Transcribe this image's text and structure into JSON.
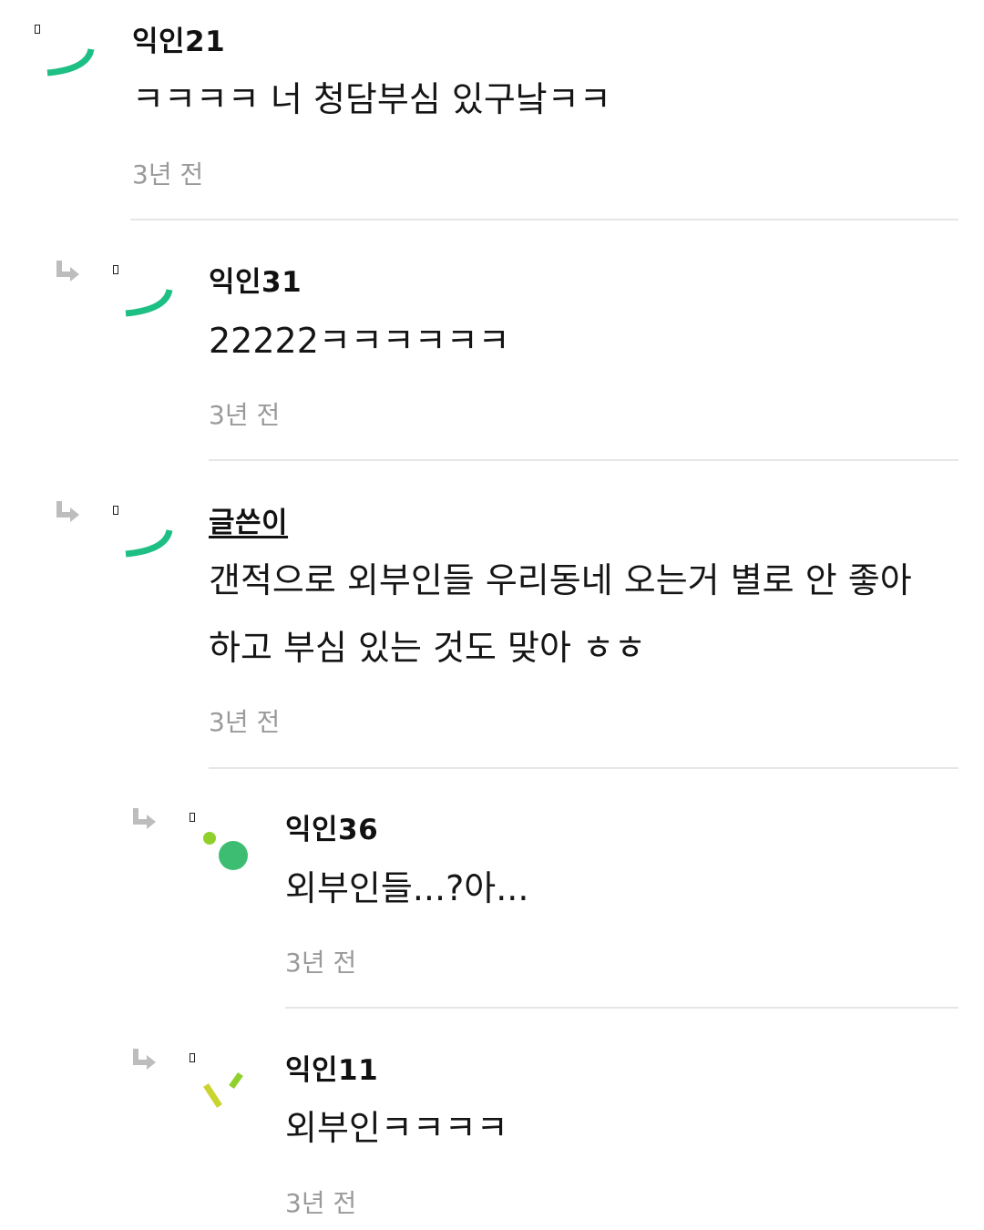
{
  "comments": [
    {
      "author": "익인21",
      "text": "ㅋㅋㅋㅋ 너 청담부심 있구낰ㅋㅋ",
      "time": "3년 전",
      "is_op": false,
      "depth": 0,
      "avatar_icon": "green-arc-avatar-icon"
    },
    {
      "author": "익인31",
      "text": "22222ㅋㅋㅋㅋㅋㅋ",
      "time": "3년 전",
      "is_op": false,
      "depth": 1,
      "avatar_icon": "green-arc-avatar-icon"
    },
    {
      "author": "글쓴이",
      "text_lines": [
        "갠적으로 외부인들 우리동네 오는거 별로 안 좋아",
        "하고 부심 있는 것도 맞아 ㅎㅎ"
      ],
      "time": "3년 전",
      "is_op": true,
      "depth": 1,
      "avatar_icon": "green-arc-avatar-icon"
    },
    {
      "author": "익인36",
      "text": "외부인들...?아...",
      "time": "3년 전",
      "is_op": false,
      "depth": 2,
      "avatar_icon": "green-dots-avatar-icon"
    },
    {
      "author": "익인11",
      "text": "외부인ㅋㅋㅋㅋ",
      "time": "3년 전",
      "is_op": false,
      "depth": 2,
      "avatar_icon": "yellow-green-slashes-avatar-icon"
    }
  ],
  "colors": {
    "avatar_green": "#1dbf85",
    "avatar_dot_green": "#3dbd72",
    "avatar_lime": "#8fd12a",
    "avatar_yellow": "#c9d42e",
    "time_gray": "#9a9a9a",
    "divider_gray": "#e6e6e6",
    "reply_arrow_gray": "#bdbdbd"
  }
}
